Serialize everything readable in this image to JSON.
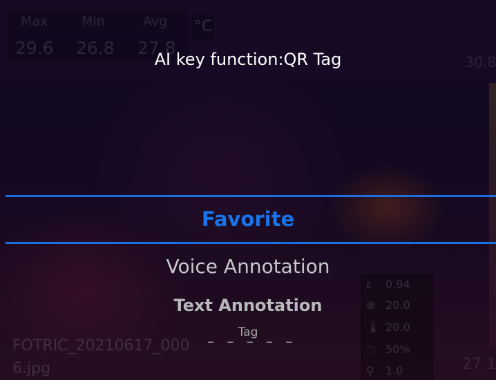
{
  "overlay": {
    "title": "AI key function:QR Tag",
    "menu": {
      "selected": "Favorite",
      "items": [
        "Voice Annotation",
        "Text Annotation",
        "Tag"
      ]
    },
    "accent_color": "#1a73e8"
  },
  "background": {
    "stats": {
      "max_label": "Max",
      "min_label": "Min",
      "avg_label": "Avg",
      "max_value": "29.6",
      "min_value": "26.8",
      "avg_value": "27.8",
      "unit": "°C"
    },
    "scale": {
      "top": "30.8",
      "bottom": "27.1"
    },
    "filename": "FOTRIC_20210617_000 6.jpg",
    "params": {
      "emissivity": "0.94",
      "reflected_temp": "20.0",
      "ambient_temp": "20.0",
      "humidity": "50%",
      "distance": "1.0"
    }
  }
}
